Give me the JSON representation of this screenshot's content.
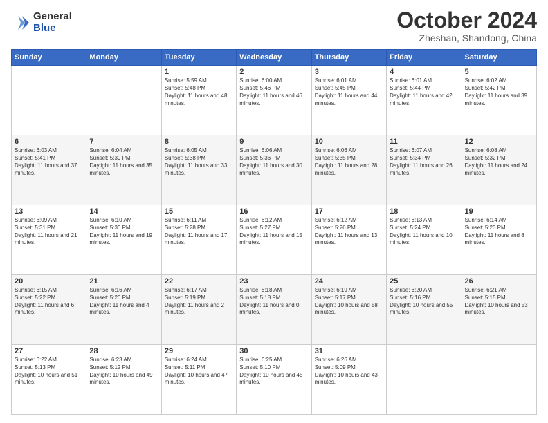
{
  "logo": {
    "general": "General",
    "blue": "Blue"
  },
  "title": "October 2024",
  "location": "Zheshan, Shandong, China",
  "days_of_week": [
    "Sunday",
    "Monday",
    "Tuesday",
    "Wednesday",
    "Thursday",
    "Friday",
    "Saturday"
  ],
  "weeks": [
    [
      {
        "num": "",
        "text": ""
      },
      {
        "num": "",
        "text": ""
      },
      {
        "num": "1",
        "text": "Sunrise: 5:59 AM\nSunset: 5:48 PM\nDaylight: 11 hours and 48 minutes."
      },
      {
        "num": "2",
        "text": "Sunrise: 6:00 AM\nSunset: 5:46 PM\nDaylight: 11 hours and 46 minutes."
      },
      {
        "num": "3",
        "text": "Sunrise: 6:01 AM\nSunset: 5:45 PM\nDaylight: 11 hours and 44 minutes."
      },
      {
        "num": "4",
        "text": "Sunrise: 6:01 AM\nSunset: 5:44 PM\nDaylight: 11 hours and 42 minutes."
      },
      {
        "num": "5",
        "text": "Sunrise: 6:02 AM\nSunset: 5:42 PM\nDaylight: 11 hours and 39 minutes."
      }
    ],
    [
      {
        "num": "6",
        "text": "Sunrise: 6:03 AM\nSunset: 5:41 PM\nDaylight: 11 hours and 37 minutes."
      },
      {
        "num": "7",
        "text": "Sunrise: 6:04 AM\nSunset: 5:39 PM\nDaylight: 11 hours and 35 minutes."
      },
      {
        "num": "8",
        "text": "Sunrise: 6:05 AM\nSunset: 5:38 PM\nDaylight: 11 hours and 33 minutes."
      },
      {
        "num": "9",
        "text": "Sunrise: 6:06 AM\nSunset: 5:36 PM\nDaylight: 11 hours and 30 minutes."
      },
      {
        "num": "10",
        "text": "Sunrise: 6:06 AM\nSunset: 5:35 PM\nDaylight: 11 hours and 28 minutes."
      },
      {
        "num": "11",
        "text": "Sunrise: 6:07 AM\nSunset: 5:34 PM\nDaylight: 11 hours and 26 minutes."
      },
      {
        "num": "12",
        "text": "Sunrise: 6:08 AM\nSunset: 5:32 PM\nDaylight: 11 hours and 24 minutes."
      }
    ],
    [
      {
        "num": "13",
        "text": "Sunrise: 6:09 AM\nSunset: 5:31 PM\nDaylight: 11 hours and 21 minutes."
      },
      {
        "num": "14",
        "text": "Sunrise: 6:10 AM\nSunset: 5:30 PM\nDaylight: 11 hours and 19 minutes."
      },
      {
        "num": "15",
        "text": "Sunrise: 6:11 AM\nSunset: 5:28 PM\nDaylight: 11 hours and 17 minutes."
      },
      {
        "num": "16",
        "text": "Sunrise: 6:12 AM\nSunset: 5:27 PM\nDaylight: 11 hours and 15 minutes."
      },
      {
        "num": "17",
        "text": "Sunrise: 6:12 AM\nSunset: 5:26 PM\nDaylight: 11 hours and 13 minutes."
      },
      {
        "num": "18",
        "text": "Sunrise: 6:13 AM\nSunset: 5:24 PM\nDaylight: 11 hours and 10 minutes."
      },
      {
        "num": "19",
        "text": "Sunrise: 6:14 AM\nSunset: 5:23 PM\nDaylight: 11 hours and 8 minutes."
      }
    ],
    [
      {
        "num": "20",
        "text": "Sunrise: 6:15 AM\nSunset: 5:22 PM\nDaylight: 11 hours and 6 minutes."
      },
      {
        "num": "21",
        "text": "Sunrise: 6:16 AM\nSunset: 5:20 PM\nDaylight: 11 hours and 4 minutes."
      },
      {
        "num": "22",
        "text": "Sunrise: 6:17 AM\nSunset: 5:19 PM\nDaylight: 11 hours and 2 minutes."
      },
      {
        "num": "23",
        "text": "Sunrise: 6:18 AM\nSunset: 5:18 PM\nDaylight: 11 hours and 0 minutes."
      },
      {
        "num": "24",
        "text": "Sunrise: 6:19 AM\nSunset: 5:17 PM\nDaylight: 10 hours and 58 minutes."
      },
      {
        "num": "25",
        "text": "Sunrise: 6:20 AM\nSunset: 5:16 PM\nDaylight: 10 hours and 55 minutes."
      },
      {
        "num": "26",
        "text": "Sunrise: 6:21 AM\nSunset: 5:15 PM\nDaylight: 10 hours and 53 minutes."
      }
    ],
    [
      {
        "num": "27",
        "text": "Sunrise: 6:22 AM\nSunset: 5:13 PM\nDaylight: 10 hours and 51 minutes."
      },
      {
        "num": "28",
        "text": "Sunrise: 6:23 AM\nSunset: 5:12 PM\nDaylight: 10 hours and 49 minutes."
      },
      {
        "num": "29",
        "text": "Sunrise: 6:24 AM\nSunset: 5:11 PM\nDaylight: 10 hours and 47 minutes."
      },
      {
        "num": "30",
        "text": "Sunrise: 6:25 AM\nSunset: 5:10 PM\nDaylight: 10 hours and 45 minutes."
      },
      {
        "num": "31",
        "text": "Sunrise: 6:26 AM\nSunset: 5:09 PM\nDaylight: 10 hours and 43 minutes."
      },
      {
        "num": "",
        "text": ""
      },
      {
        "num": "",
        "text": ""
      }
    ]
  ]
}
